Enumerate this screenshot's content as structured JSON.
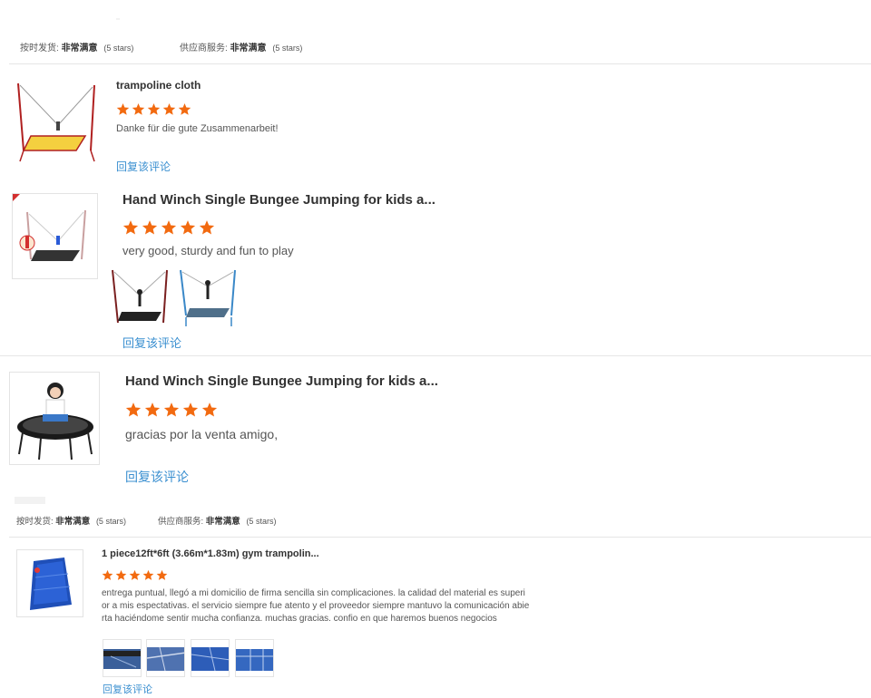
{
  "seller_rating_top": {
    "shipping_label": "按时发货:",
    "shipping_value": "非常满意",
    "shipping_stars": "(5 stars)",
    "service_label": "供应商服务:",
    "service_value": "非常满意",
    "service_stars": "(5 stars)"
  },
  "reviews": [
    {
      "title": "trampoline cloth",
      "stars": 5,
      "text": "Danke für die gute Zusammenarbeit!",
      "reply": "回复该评论"
    },
    {
      "title": "Hand Winch Single Bungee Jumping for kids a...",
      "stars": 5,
      "text": "very good, sturdy and fun to play",
      "reply": "回复该评论"
    },
    {
      "title": "Hand Winch Single Bungee Jumping for kids a...",
      "stars": 5,
      "text": "gracias por la venta amigo,",
      "reply": "回复该评论"
    },
    {
      "title": "1 piece12ft*6ft (3.66m*1.83m) gym trampolin...",
      "stars": 5,
      "text_lines": [
        "entrega puntual, llegó a mi domicilio de firma sencilla sin complicaciones. la calidad del material es superi",
        "or a mis espectativas. el servicio siempre fue atento y el proveedor siempre mantuvo la comunicación abie",
        "rta haciéndome sentir mucha confianza. muchas gracias. confio en que haremos buenos negocios"
      ],
      "reply": "回复该评论"
    }
  ],
  "seller_rating_bottom": {
    "shipping_label": "按时发货:",
    "shipping_value": "非常满意",
    "shipping_stars": "(5 stars)",
    "service_label": "供应商服务:",
    "service_value": "非常满意",
    "service_stars": "(5 stars)"
  },
  "colors": {
    "star": "#f26a10",
    "link": "#3a8fd0",
    "divider": "#e6e6e6"
  },
  "icons": [
    "star-icon"
  ]
}
